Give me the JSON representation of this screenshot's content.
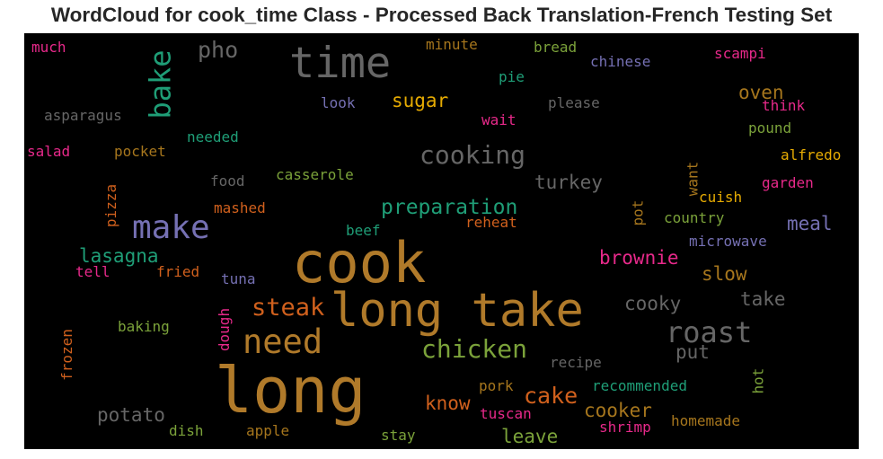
{
  "title": "WordCloud for cook_time Class - Processed Back Translation-French Testing Set",
  "palette": {
    "gold": "#b07a2a",
    "orange": "#d0601d",
    "green": "#7ba23a",
    "teal": "#1f9e77",
    "purple": "#7570b3",
    "pink": "#e7298a",
    "gray": "#666666",
    "yellow": "#e6ab02",
    "brown": "#a6761d"
  },
  "words": {
    "cook": "cook",
    "long": "long",
    "long_take": "long take",
    "time": "time",
    "make": "make",
    "need": "need",
    "roast": "roast",
    "chicken": "chicken",
    "cooking": "cooking",
    "bake": "bake",
    "steak": "steak",
    "cake": "cake",
    "preparation": "preparation",
    "lasagna": "lasagna",
    "brownie": "brownie",
    "oven": "oven",
    "meal": "meal",
    "slow": "slow",
    "take": "take",
    "cooky": "cooky",
    "turkey": "turkey",
    "sugar": "sugar",
    "pho": "pho",
    "cooker": "cooker",
    "potato": "potato",
    "put": "put",
    "know": "know",
    "leave": "leave",
    "much": "much",
    "minute": "minute",
    "bread": "bread",
    "chinese": "chinese",
    "scampi": "scampi",
    "pie": "pie",
    "asparagus": "asparagus",
    "look": "look",
    "please": "please",
    "think": "think",
    "wait": "wait",
    "needed": "needed",
    "pound": "pound",
    "salad": "salad",
    "pocket": "pocket",
    "alfredo": "alfredo",
    "food": "food",
    "casserole": "casserole",
    "want": "want",
    "garden": "garden",
    "pizza": "pizza",
    "mashed": "mashed",
    "pot": "pot",
    "cuish": "cuish",
    "country": "country",
    "reheat": "reheat",
    "beef": "beef",
    "microwave": "microwave",
    "tell": "tell",
    "fried": "fried",
    "tuna": "tuna",
    "baking": "baking",
    "dough": "dough",
    "frozen": "frozen",
    "recipe": "recipe",
    "hot": "hot",
    "pork": "pork",
    "recommended": "recommended",
    "tuscan": "tuscan",
    "shrimp": "shrimp",
    "homemade": "homemade",
    "dish": "dish",
    "apple": "apple",
    "stay": "stay"
  }
}
